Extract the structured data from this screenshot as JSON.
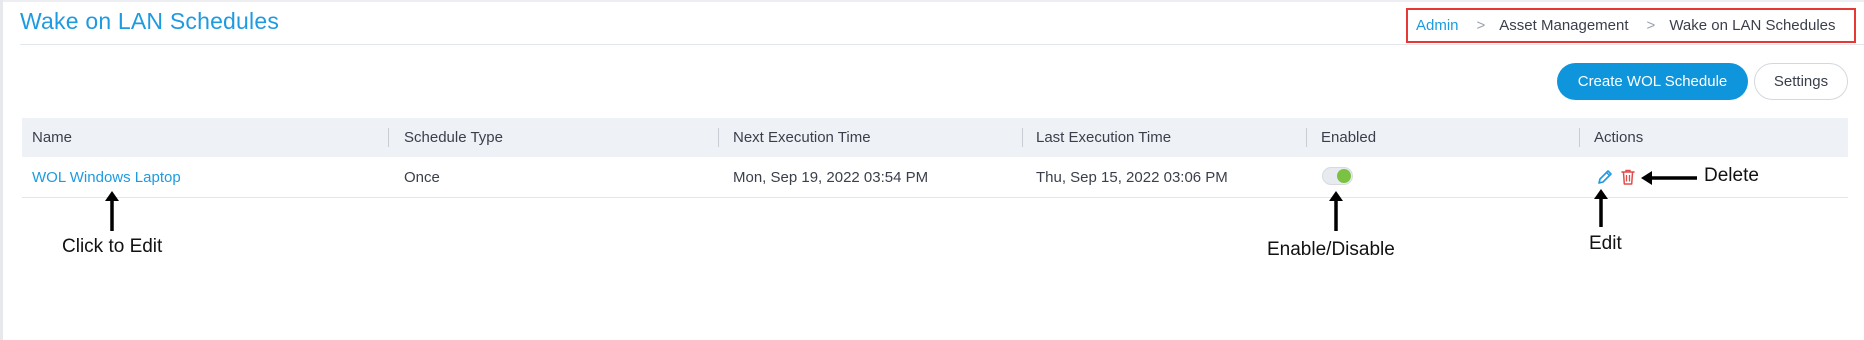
{
  "page": {
    "title": "Wake on LAN Schedules"
  },
  "breadcrumb": {
    "items": [
      "Admin",
      "Asset Management",
      "Wake on LAN Schedules"
    ],
    "separator": ">"
  },
  "toolbar": {
    "create_label": "Create WOL Schedule",
    "settings_label": "Settings"
  },
  "table": {
    "columns": [
      "Name",
      "Schedule Type",
      "Next Execution Time",
      "Last Execution Time",
      "Enabled",
      "Actions"
    ],
    "rows": [
      {
        "name": "WOL Windows Laptop",
        "schedule_type": "Once",
        "next_execution": "Mon, Sep 19, 2022 03:54 PM",
        "last_execution": "Thu, Sep 15, 2022 03:06 PM",
        "enabled": true
      }
    ]
  },
  "annotations": {
    "click_to_edit": "Click to Edit",
    "enable_disable": "Enable/Disable",
    "edit": "Edit",
    "delete": "Delete"
  },
  "colors": {
    "accent": "#1e9be0",
    "primary_button": "#0e95db",
    "toggle_on": "#7cc242",
    "delete_icon": "#e34b4b",
    "highlight_box": "#e53935"
  },
  "icons": {
    "edit": "pencil-icon",
    "delete": "trash-icon",
    "separator": "chevron-right-icon"
  }
}
